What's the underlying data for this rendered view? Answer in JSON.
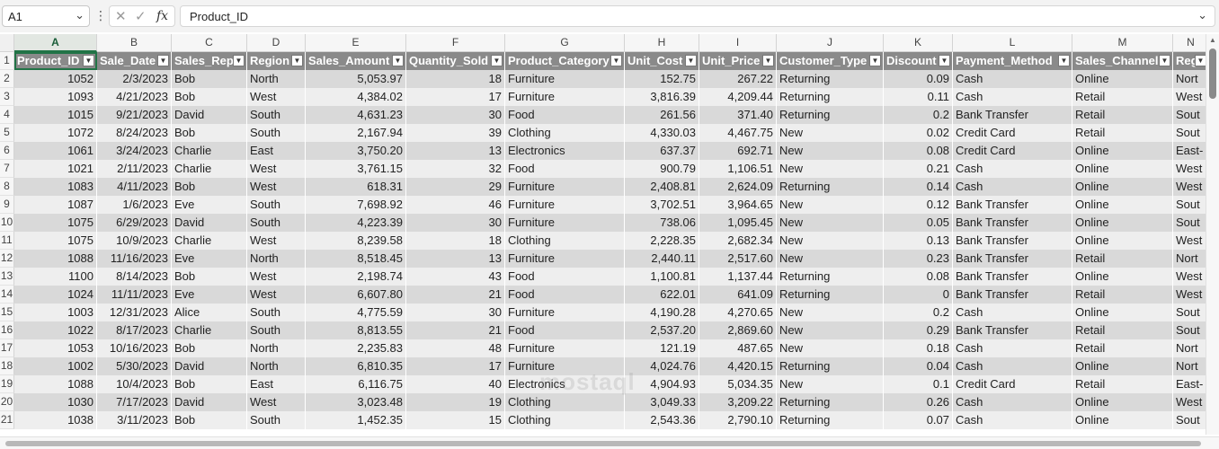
{
  "formula_bar": {
    "name_box": "A1",
    "formula": "Product_ID",
    "kebab": "⋮",
    "cancel_icon": "✕",
    "enter_icon": "✓",
    "fx_label": "fx"
  },
  "column_letters": [
    "A",
    "B",
    "C",
    "D",
    "E",
    "F",
    "G",
    "H",
    "I",
    "J",
    "K",
    "L",
    "M",
    "N"
  ],
  "headers": [
    "Product_ID",
    "Sale_Date",
    "Sales_Rep",
    "Region",
    "Sales_Amount",
    "Quantity_Sold",
    "Product_Category",
    "Unit_Cost",
    "Unit_Price",
    "Customer_Type",
    "Discount",
    "Payment_Method",
    "Sales_Channel",
    "Regi"
  ],
  "rows": [
    {
      "n": "2",
      "cells": [
        "1052",
        "2/3/2023",
        "Bob",
        "North",
        "5,053.97",
        "18",
        "Furniture",
        "152.75",
        "267.22",
        "Returning",
        "0.09",
        "Cash",
        "Online",
        "Nort"
      ]
    },
    {
      "n": "3",
      "cells": [
        "1093",
        "4/21/2023",
        "Bob",
        "West",
        "4,384.02",
        "17",
        "Furniture",
        "3,816.39",
        "4,209.44",
        "Returning",
        "0.11",
        "Cash",
        "Retail",
        "West"
      ]
    },
    {
      "n": "4",
      "cells": [
        "1015",
        "9/21/2023",
        "David",
        "South",
        "4,631.23",
        "30",
        "Food",
        "261.56",
        "371.40",
        "Returning",
        "0.2",
        "Bank Transfer",
        "Retail",
        "Sout"
      ]
    },
    {
      "n": "5",
      "cells": [
        "1072",
        "8/24/2023",
        "Bob",
        "South",
        "2,167.94",
        "39",
        "Clothing",
        "4,330.03",
        "4,467.75",
        "New",
        "0.02",
        "Credit Card",
        "Retail",
        "Sout"
      ]
    },
    {
      "n": "6",
      "cells": [
        "1061",
        "3/24/2023",
        "Charlie",
        "East",
        "3,750.20",
        "13",
        "Electronics",
        "637.37",
        "692.71",
        "New",
        "0.08",
        "Credit Card",
        "Online",
        "East-"
      ]
    },
    {
      "n": "7",
      "cells": [
        "1021",
        "2/11/2023",
        "Charlie",
        "West",
        "3,761.15",
        "32",
        "Food",
        "900.79",
        "1,106.51",
        "New",
        "0.21",
        "Cash",
        "Online",
        "West"
      ]
    },
    {
      "n": "8",
      "cells": [
        "1083",
        "4/11/2023",
        "Bob",
        "West",
        "618.31",
        "29",
        "Furniture",
        "2,408.81",
        "2,624.09",
        "Returning",
        "0.14",
        "Cash",
        "Online",
        "West"
      ]
    },
    {
      "n": "9",
      "cells": [
        "1087",
        "1/6/2023",
        "Eve",
        "South",
        "7,698.92",
        "46",
        "Furniture",
        "3,702.51",
        "3,964.65",
        "New",
        "0.12",
        "Bank Transfer",
        "Online",
        "Sout"
      ]
    },
    {
      "n": "10",
      "cells": [
        "1075",
        "6/29/2023",
        "David",
        "South",
        "4,223.39",
        "30",
        "Furniture",
        "738.06",
        "1,095.45",
        "New",
        "0.05",
        "Bank Transfer",
        "Online",
        "Sout"
      ]
    },
    {
      "n": "11",
      "cells": [
        "1075",
        "10/9/2023",
        "Charlie",
        "West",
        "8,239.58",
        "18",
        "Clothing",
        "2,228.35",
        "2,682.34",
        "New",
        "0.13",
        "Bank Transfer",
        "Online",
        "West"
      ]
    },
    {
      "n": "12",
      "cells": [
        "1088",
        "11/16/2023",
        "Eve",
        "North",
        "8,518.45",
        "13",
        "Furniture",
        "2,440.11",
        "2,517.60",
        "New",
        "0.23",
        "Bank Transfer",
        "Retail",
        "Nort"
      ]
    },
    {
      "n": "13",
      "cells": [
        "1100",
        "8/14/2023",
        "Bob",
        "West",
        "2,198.74",
        "43",
        "Food",
        "1,100.81",
        "1,137.44",
        "Returning",
        "0.08",
        "Bank Transfer",
        "Online",
        "West"
      ]
    },
    {
      "n": "14",
      "cells": [
        "1024",
        "11/11/2023",
        "Eve",
        "West",
        "6,607.80",
        "21",
        "Food",
        "622.01",
        "641.09",
        "Returning",
        "0",
        "Bank Transfer",
        "Retail",
        "West"
      ]
    },
    {
      "n": "15",
      "cells": [
        "1003",
        "12/31/2023",
        "Alice",
        "South",
        "4,775.59",
        "30",
        "Furniture",
        "4,190.28",
        "4,270.65",
        "New",
        "0.2",
        "Cash",
        "Online",
        "Sout"
      ]
    },
    {
      "n": "16",
      "cells": [
        "1022",
        "8/17/2023",
        "Charlie",
        "South",
        "8,813.55",
        "21",
        "Food",
        "2,537.20",
        "2,869.60",
        "New",
        "0.29",
        "Bank Transfer",
        "Retail",
        "Sout"
      ]
    },
    {
      "n": "17",
      "cells": [
        "1053",
        "10/16/2023",
        "Bob",
        "North",
        "2,235.83",
        "48",
        "Furniture",
        "121.19",
        "487.65",
        "New",
        "0.18",
        "Cash",
        "Retail",
        "Nort"
      ]
    },
    {
      "n": "18",
      "cells": [
        "1002",
        "5/30/2023",
        "David",
        "North",
        "6,810.35",
        "17",
        "Furniture",
        "4,024.76",
        "4,420.15",
        "Returning",
        "0.04",
        "Cash",
        "Online",
        "Nort"
      ]
    },
    {
      "n": "19",
      "cells": [
        "1088",
        "10/4/2023",
        "Bob",
        "East",
        "6,116.75",
        "40",
        "Electronics",
        "4,904.93",
        "5,034.35",
        "New",
        "0.1",
        "Credit Card",
        "Retail",
        "East-"
      ]
    },
    {
      "n": "20",
      "cells": [
        "1030",
        "7/17/2023",
        "David",
        "West",
        "3,023.48",
        "19",
        "Clothing",
        "3,049.33",
        "3,209.22",
        "Returning",
        "0.26",
        "Cash",
        "Online",
        "West"
      ]
    },
    {
      "n": "21",
      "cells": [
        "1038",
        "3/11/2023",
        "Bob",
        "South",
        "1,452.35",
        "15",
        "Clothing",
        "2,543.36",
        "2,790.10",
        "Returning",
        "0.07",
        "Cash",
        "Online",
        "Sout"
      ]
    }
  ],
  "watermark": "khamsat / mostaql"
}
